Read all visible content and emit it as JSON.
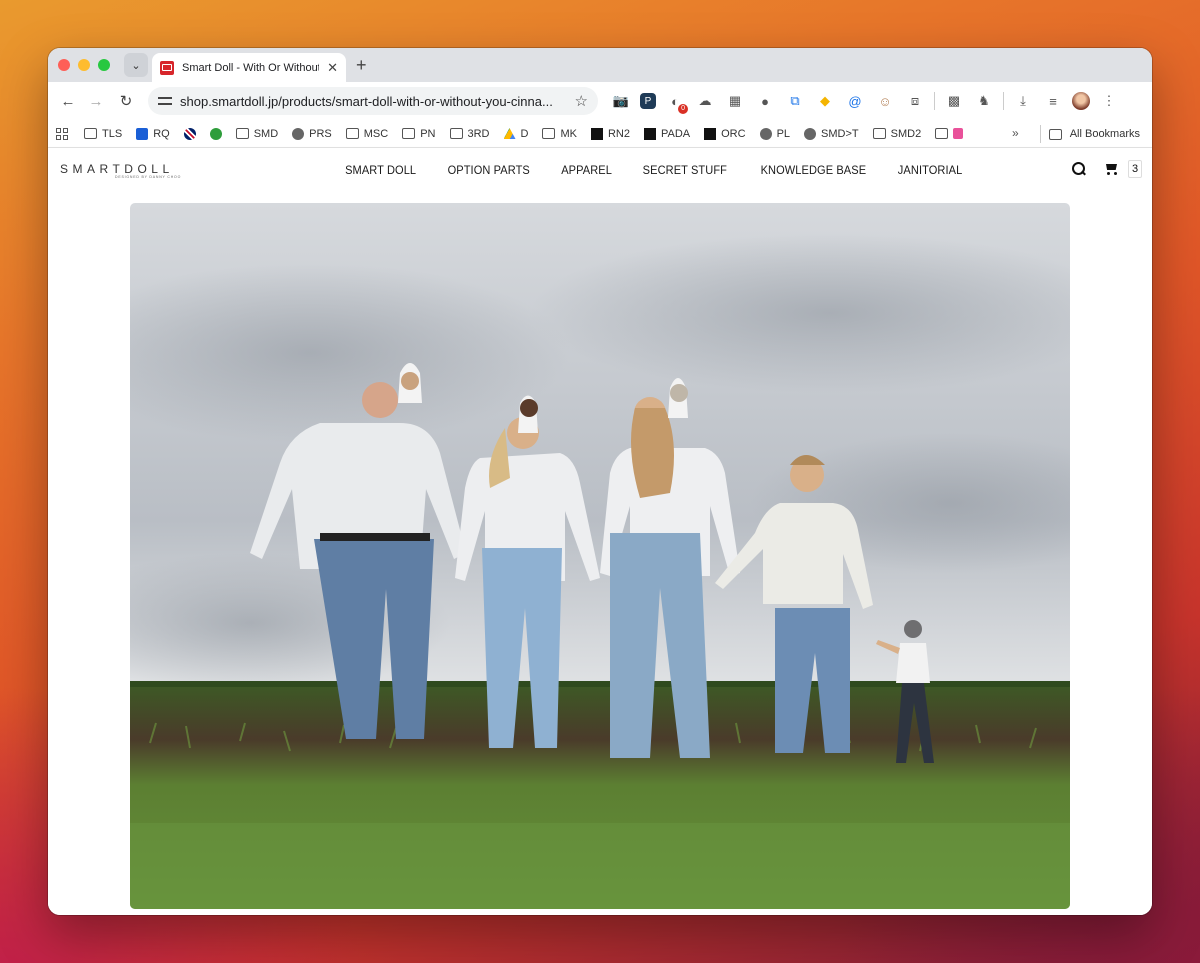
{
  "browser": {
    "tab": {
      "title": "Smart Doll - With Or Without You Cinnamon"
    },
    "address_bar": {
      "url": "shop.smartdoll.jp/products/smart-doll-with-or-without-you-cinna..."
    },
    "extensions": {
      "badge_count": "0"
    },
    "bookmarks": [
      {
        "label": "TLS",
        "icon": "folder-icon"
      },
      {
        "label": "RQ",
        "icon": "dropbox-icon"
      },
      {
        "label": "",
        "icon": "uk-flag-icon"
      },
      {
        "label": "",
        "icon": "green-circle-icon"
      },
      {
        "label": "SMD",
        "icon": "folder-icon"
      },
      {
        "label": "PRS",
        "icon": "globe-icon"
      },
      {
        "label": "MSC",
        "icon": "folder-icon"
      },
      {
        "label": "PN",
        "icon": "folder-icon"
      },
      {
        "label": "3RD",
        "icon": "folder-icon"
      },
      {
        "label": "D",
        "icon": "drive-icon"
      },
      {
        "label": "MK",
        "icon": "folder-icon"
      },
      {
        "label": "RN2",
        "icon": "smartdoll-icon"
      },
      {
        "label": "PADA",
        "icon": "smartdoll-icon"
      },
      {
        "label": "ORC",
        "icon": "smartdoll-icon"
      },
      {
        "label": "PL",
        "icon": "globe-icon"
      },
      {
        "label": "SMD>T",
        "icon": "globe-icon"
      },
      {
        "label": "SMD2",
        "icon": "folder-icon"
      },
      {
        "label": "",
        "icon": "folder-icon"
      }
    ],
    "all_bookmarks_label": "All Bookmarks",
    "more_label": "»"
  },
  "site": {
    "logo_text": "SMARTDOLL",
    "logo_subtext": "DESIGNED BY DANNY CHOO",
    "nav": [
      "SMART DOLL",
      "OPTION PARTS",
      "APPAREL",
      "SECRET STUFF",
      "KNOWLEDGE BASE",
      "JANITORIAL"
    ],
    "cart_count": "3"
  },
  "colors": {
    "accent_red": "#d7262b",
    "sky": "#c9ced4",
    "grass": "#4f7a2c"
  }
}
